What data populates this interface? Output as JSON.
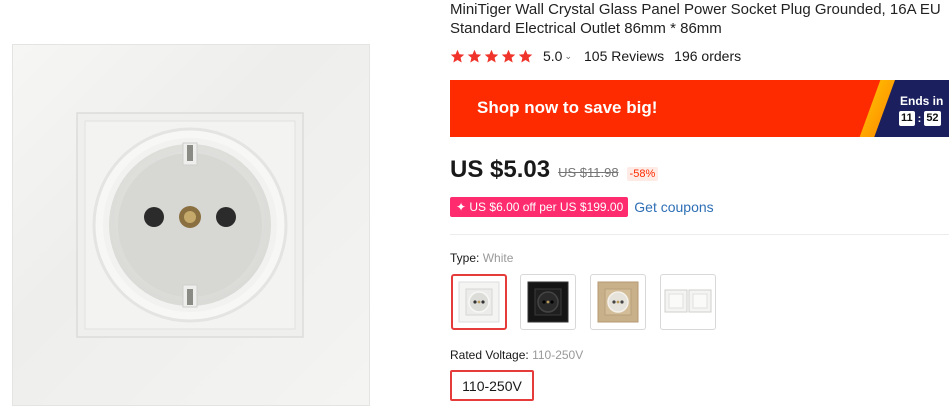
{
  "product": {
    "title": "MiniTiger Wall Crystal Glass Panel Power Socket Plug Grounded, 16A EU Standard Electrical Outlet 86mm * 86mm",
    "main_image_icon": "white-eu-socket-image"
  },
  "rating": {
    "stars": 5,
    "score": "5.0",
    "reviews": "105 Reviews",
    "orders": "196 orders",
    "star_color": "#f0332b"
  },
  "banner": {
    "text": "Shop now to save big!",
    "ends_in": "Ends in",
    "timer": [
      "11",
      "52"
    ],
    "bg_color": "#fe2b00"
  },
  "price": {
    "current": "US $5.03",
    "original": "US $11.98",
    "discount": "-58%"
  },
  "coupon": {
    "tag": "✦ US $6.00 off per US $199.00",
    "link": "Get coupons"
  },
  "type_option": {
    "label": "Type: ",
    "value": "White",
    "swatches": [
      {
        "name": "white-socket-swatch",
        "selected": true
      },
      {
        "name": "black-socket-swatch",
        "selected": false
      },
      {
        "name": "gold-socket-swatch",
        "selected": false
      },
      {
        "name": "white-switch-swatch",
        "selected": false
      }
    ]
  },
  "voltage_option": {
    "label": "Rated Voltage: ",
    "value": "110-250V",
    "selected_button": "110-250V"
  }
}
